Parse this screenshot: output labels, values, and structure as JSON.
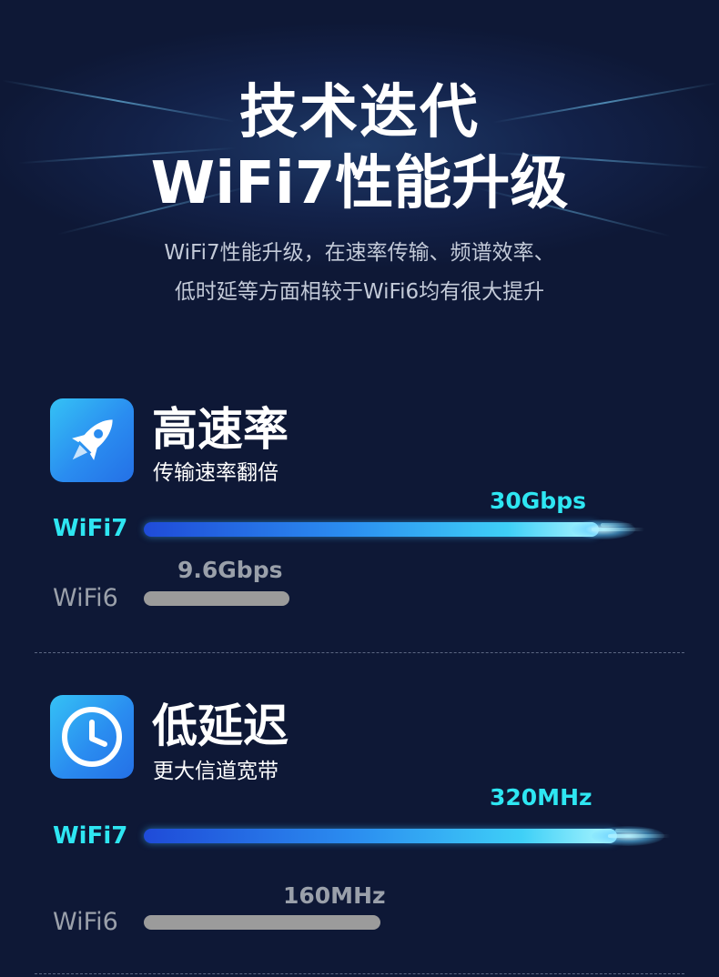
{
  "hero": {
    "title_line1": "技术迭代",
    "title_line2": "WiFi7性能升级",
    "subtitle_line1": "WiFi7性能升级，在速率传输、频谱效率、",
    "subtitle_line2": "低时延等方面相较于WiFi6均有很大提升"
  },
  "features": [
    {
      "icon": "rocket-icon",
      "title": "高速率",
      "desc": "传输速率翻倍",
      "wifi7": {
        "label": "WiFi7",
        "value": "30Gbps",
        "level": 1.0
      },
      "wifi6": {
        "label": "WiFi6",
        "value": "9.6Gbps",
        "level": 0.32
      }
    },
    {
      "icon": "clock-icon",
      "title": "低延迟",
      "desc": "更大信道宽带",
      "wifi7": {
        "label": "WiFi7",
        "value": "320MHz",
        "level": 1.0
      },
      "wifi6": {
        "label": "WiFi6",
        "value": "160MHz",
        "level": 0.5
      }
    }
  ],
  "colors": {
    "background": "#0e1836",
    "accent_cyan": "#2ee6f2",
    "icon_blue": "#2a8cf0",
    "muted_gray": "#9b9b9b"
  }
}
